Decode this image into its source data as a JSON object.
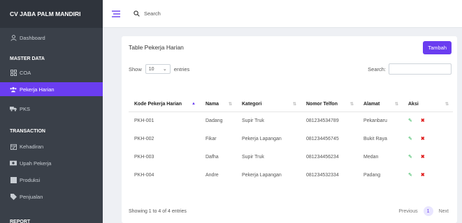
{
  "app": {
    "brand": "CV JABA PALM MANDIRI"
  },
  "topbar": {
    "search_label": "Search"
  },
  "sidebar": {
    "dashboard": "Dashboard",
    "master_data": "MASTER DATA",
    "coa": "COA",
    "pekerja_harian": "Pekerja Harian",
    "pks": "PKS",
    "transaction": "TRANSACTION",
    "kehadiran": "Kehadiran",
    "upah_pekerja": "Upah Pekerja",
    "produksi": "Produksi",
    "penjualan": "Penjualan",
    "report": "REPORT"
  },
  "card": {
    "title": "Table Pekerja Harian",
    "tambah": "Tambah",
    "show": "Show",
    "entries_value": "10",
    "entries": "entries",
    "search_label": "Search:"
  },
  "table": {
    "headers": [
      "Kode Pekerja Harian",
      "Nama",
      "Kategori",
      "Nomor Telfon",
      "Alamat",
      "Aksi"
    ],
    "rows": [
      [
        "PKH-001",
        "Dadang",
        "Supir Truk",
        "081234534789",
        "Pekanbaru"
      ],
      [
        "PKH-002",
        "Fikar",
        "Pekerja Lapangan",
        "081234456745",
        "Bukit Raya"
      ],
      [
        "PKH-003",
        "Dafha",
        "Supir Truk",
        "081234456234",
        "Medan"
      ],
      [
        "PKH-004",
        "Andre",
        "Pekerja Lapangan",
        "081234532334",
        "Padang"
      ]
    ]
  },
  "footer": {
    "info": "Showing 1 to 4 of 4 entries",
    "previous": "Previous",
    "page": "1",
    "next": "Next"
  },
  "colors": {
    "accent": "#6a3df0",
    "sidebar": "#3a4049",
    "edit": "#22b14c",
    "delete": "#e02020"
  }
}
